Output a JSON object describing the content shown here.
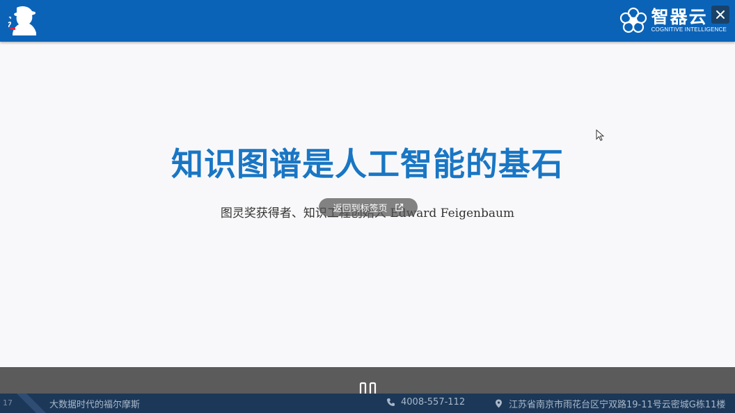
{
  "header": {
    "brand_name": "智器云",
    "brand_sub": "COGNITIVE INTELLIGENCE",
    "colors": {
      "bar": "#0b63b8"
    }
  },
  "slide": {
    "title": "知识图谱是人工智能的基石",
    "subtitle": "图灵奖获得者、知识工程创始人 Edward Feigenbaum",
    "title_color": "#1976c4"
  },
  "overlay": {
    "return_label": "返回到标签页",
    "return_icon": "external-link-icon"
  },
  "controls": {
    "pause_icon": "pause-icon"
  },
  "footer": {
    "page_number": "17",
    "title": "大数据时代的福尔摩斯",
    "phone": "4008-557-112",
    "address": "江苏省南京市雨花台区宁双路19-11号云密城G栋11楼"
  }
}
